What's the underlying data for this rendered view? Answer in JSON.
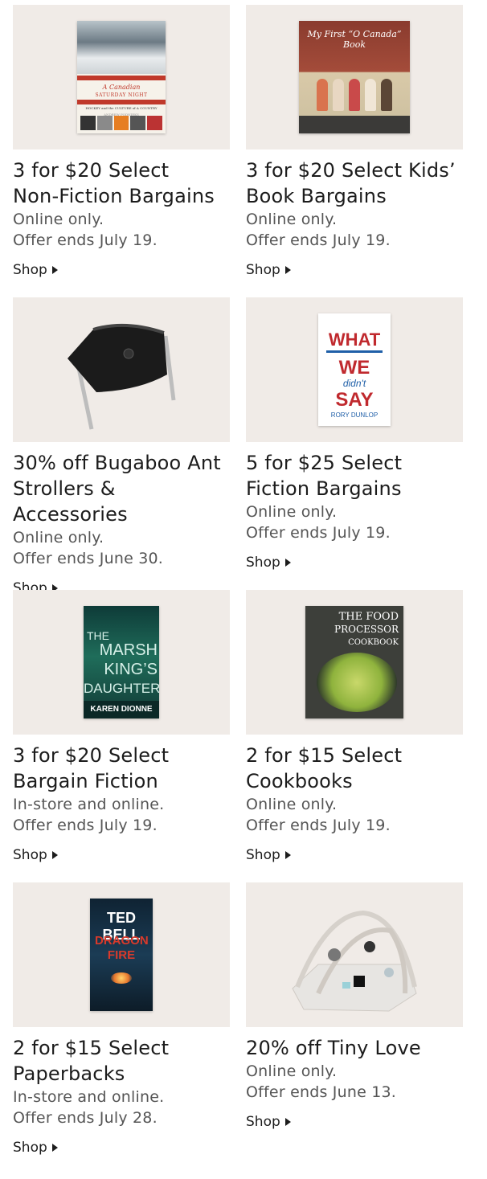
{
  "promos": [
    {
      "title_line1": "3 for $20 Select",
      "title_line2": "Non-Fiction Bargains",
      "line1": "Online only.",
      "line2": "Offer ends July 19.",
      "shop": "Shop",
      "cover": {
        "title": "A Canadian",
        "subtitle": "SATURDAY NIGHT",
        "tagline": "HOCKEY and the CULTURE of A COUNTRY",
        "author": "ANDREW PODNIEKS"
      }
    },
    {
      "title_line1": "3 for $20 Select Kids’",
      "title_line2": "Book Bargains",
      "line1": "Online only.",
      "line2": "Offer ends July 19.",
      "shop": "Shop",
      "cover": {
        "title": "My First “O Canada” Book"
      }
    },
    {
      "title_line1": "30% off Bugaboo Ant",
      "title_line2": "Strollers & Accessories",
      "line1": "Online only.",
      "line2": "Offer ends June 30.",
      "shop": "Shop"
    },
    {
      "title_line1": "5 for $25 Select",
      "title_line2": "Fiction Bargains",
      "line1": "Online only.",
      "line2": "Offer ends July 19.",
      "shop": "Shop",
      "cover": {
        "w1": "WHAT",
        "w2": "WE",
        "w3": "didn't",
        "w4": "SAY",
        "author": "RORY DUNLOP"
      }
    },
    {
      "title_line1": "3 for $20 Select",
      "title_line2": "Bargain Fiction",
      "line1": "In-store and online.",
      "line2": "Offer ends July 19.",
      "shop": "Shop",
      "cover": {
        "w1": "THE",
        "w2": "MARSH",
        "w3": "KING’S",
        "w4": "DAUGHTER",
        "author": "KAREN DIONNE"
      }
    },
    {
      "title_line1": "2 for $15 Select",
      "title_line2": "Cookbooks",
      "line1": "Online only.",
      "line2": "Offer ends July 19.",
      "shop": "Shop",
      "cover": {
        "w1": "THE FOOD",
        "w2": "PROCESSOR",
        "w3": "COOKBOOK"
      }
    },
    {
      "title_line1": "2 for $15 Select",
      "title_line2": "Paperbacks",
      "line1": "In-store and online.",
      "line2": "Offer ends July 28.",
      "shop": "Shop",
      "cover": {
        "author": "TED BELL",
        "title": "DRAGON FIRE"
      }
    },
    {
      "title_line1": "20% off Tiny Love",
      "title_line2": "",
      "line1": "Online only.",
      "line2": "Offer ends June 13.",
      "shop": "Shop"
    }
  ],
  "colors": {
    "card_bg": "#f0ebe7",
    "text": "#1c1c1c",
    "subtext": "#555555"
  }
}
